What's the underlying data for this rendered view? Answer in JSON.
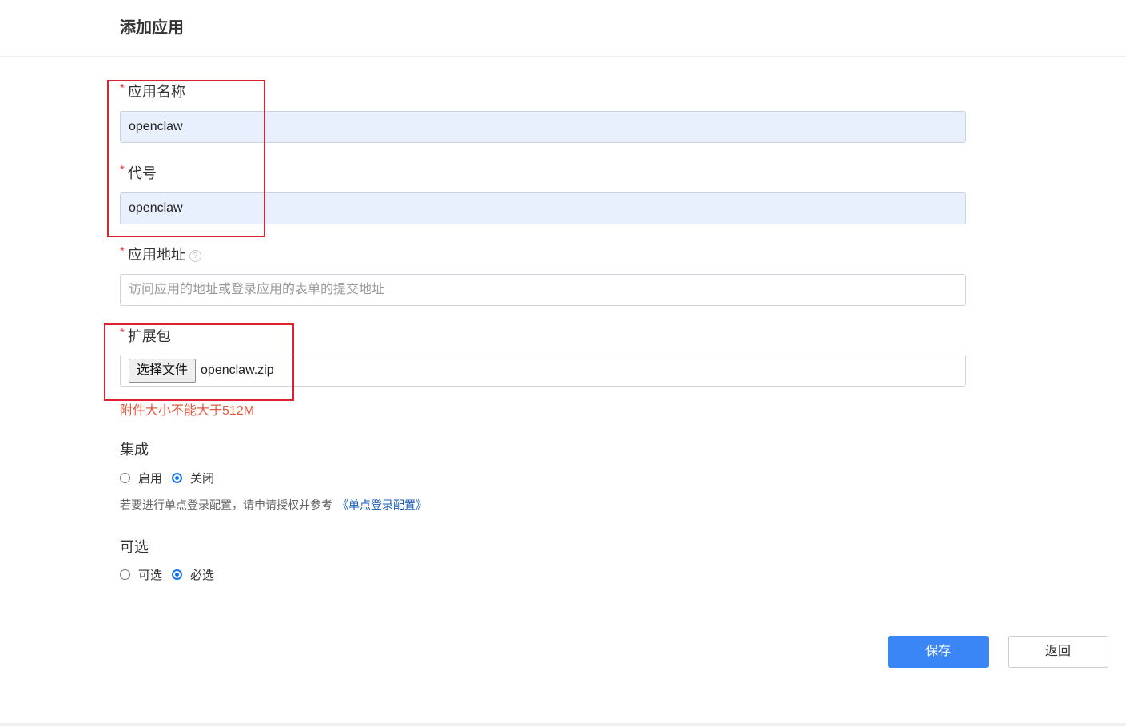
{
  "page": {
    "title": "添加应用"
  },
  "form": {
    "app_name": {
      "required_mark": "*",
      "label": "应用名称",
      "value": "openclaw"
    },
    "code": {
      "required_mark": "*",
      "label": "代号",
      "value": "openclaw"
    },
    "app_url": {
      "required_mark": "*",
      "label": "应用地址",
      "help_icon": "?",
      "placeholder": "访问应用的地址或登录应用的表单的提交地址"
    },
    "package": {
      "required_mark": "*",
      "label": "扩展包",
      "choose_button": "选择文件",
      "file_name": "openclaw.zip",
      "size_hint": "附件大小不能大于512M"
    },
    "integration": {
      "label": "集成",
      "options": [
        {
          "label": "启用",
          "checked": false
        },
        {
          "label": "关闭",
          "checked": true
        }
      ],
      "hint": "若要进行单点登录配置，请申请授权并参考",
      "hint_link": "《单点登录配置》"
    },
    "optional": {
      "label": "可选",
      "options": [
        {
          "label": "可选",
          "checked": false
        },
        {
          "label": "必选",
          "checked": true
        }
      ]
    }
  },
  "actions": {
    "save": "保存",
    "back": "返回"
  },
  "colors": {
    "primary": "#3a86f7",
    "required": "#e4393c",
    "error": "#e5583f",
    "link": "#1a5fb4",
    "annotation": "#e0202e"
  }
}
